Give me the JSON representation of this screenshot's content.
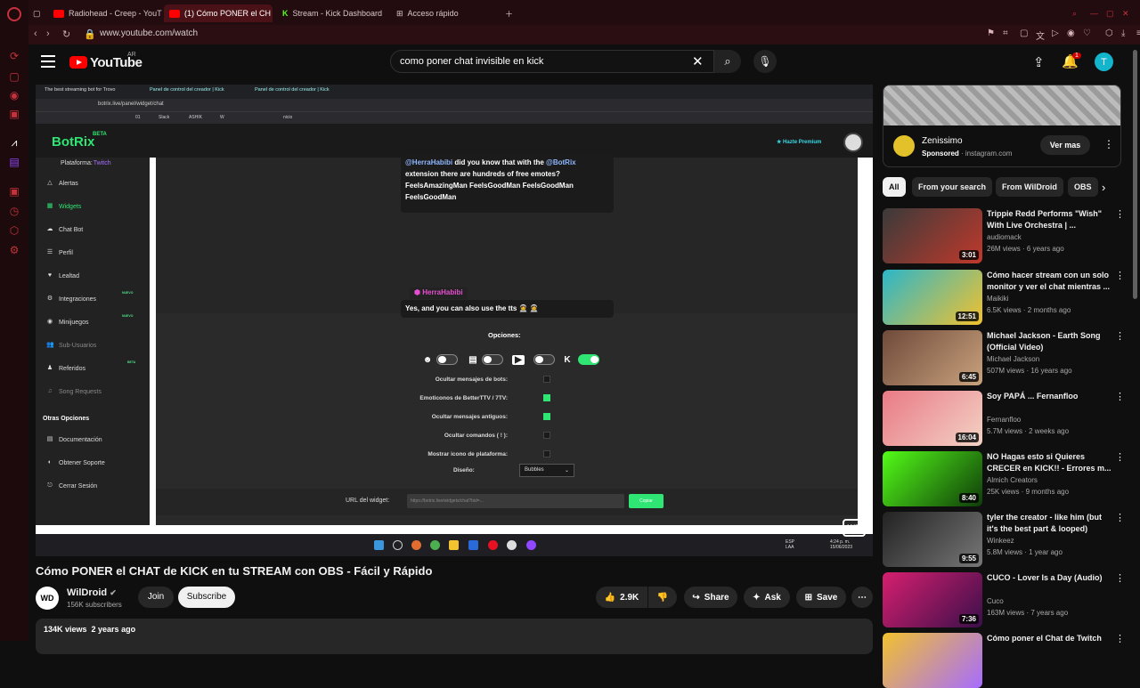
{
  "browser": {
    "tabs": [
      {
        "label": "Radiohead - Creep - YouT",
        "color": "#ff0000"
      },
      {
        "label": "(1) Cómo PONER el CH",
        "color": "#ff0000"
      },
      {
        "label": "Stream - Kick Dashboard",
        "color": "#53fc18"
      },
      {
        "label": "Acceso rápido",
        "color": "#888888"
      }
    ],
    "url": "www.youtube.com/watch"
  },
  "youtube": {
    "brand": "YouTube",
    "region": "AR",
    "search_query": "como poner chat invisible en kick",
    "notif_count": "1",
    "avatar_letter": "T"
  },
  "video_frame": {
    "tabs": [
      "The best streaming bot for Trovo",
      "Panel de control del creador | Kick",
      "Panel de control del creador | Kick"
    ],
    "url": "botrix.live/panel/widget/chat",
    "bookmarks": [
      "01",
      "Slack",
      "ASHIK",
      "W",
      "nicio"
    ],
    "logo": "BotRix",
    "beta": "BETA",
    "premium": "Hazte Premium",
    "platform_line": "Plataforma: ",
    "platform_value": "Twitch",
    "side_items": [
      {
        "label": "Alertas",
        "icon": "△"
      },
      {
        "label": "Widgets",
        "icon": "▦"
      },
      {
        "label": "Chat Bot",
        "icon": "☁"
      },
      {
        "label": "Perfil",
        "icon": "☰"
      },
      {
        "label": "Lealtad",
        "icon": "♥"
      },
      {
        "label": "Integraciones",
        "icon": "⚙"
      },
      {
        "label": "Minijuegos",
        "icon": "◉"
      },
      {
        "label": "Sub-Usuarios",
        "icon": "👥"
      },
      {
        "label": "Referidos",
        "icon": "♟"
      },
      {
        "label": "Song Requests",
        "icon": "♫"
      }
    ],
    "nuevo": "NUEVO",
    "beta_small": "BETA",
    "other_options": "Otras Opciones",
    "other_items": [
      {
        "label": "Documentación",
        "icon": "▤"
      },
      {
        "label": "Obtener Soporte",
        "icon": "◐"
      },
      {
        "label": "Cerrar Sesión",
        "icon": "⎋"
      }
    ],
    "chat_mention1": "@HerraHabibi",
    "chat_text1": " did you know that with the ",
    "chat_mention2": "@BotRix",
    "chat_text2": " extension there are hundreds of free emotes? FeelsAmazingMan FeelsGoodMan FeelsGoodMan FeelsGoodMan",
    "chat_user": "HerraHabibi",
    "chat_text3": "Yes, and you can also use the tts 🧑‍🚀 🧑‍🚀",
    "options_title": "Opciones:",
    "options": [
      {
        "label": "Ocultar mensajes de bots:",
        "checked": false
      },
      {
        "label": "Emoticonos de BetterTTV / 7TV:",
        "checked": true
      },
      {
        "label": "Ocultar mensajes antiguos:",
        "checked": true
      },
      {
        "label": "Ocultar comandos ( ! ):",
        "checked": false
      },
      {
        "label": "Mostrar icono de plataforma:",
        "checked": false
      }
    ],
    "design_label": "Diseño:",
    "design_value": "Bubbles",
    "url_label": "URL del widget:",
    "url_value": "https://botrix.live/widgets/chat?bid=...",
    "copy_label": "Copiar",
    "tb_lang": "ESP\nLAA",
    "tb_time": "4:24 p. m.\n15/06/2023",
    "watermark": "WD"
  },
  "video": {
    "title": "Cómo PONER el CHAT de KICK en tu STREAM con OBS - Fácil y Rápido",
    "channel": "WilDroid",
    "subscribers": "156K subscribers",
    "join": "Join",
    "subscribe": "Subscribe",
    "likes": "2.9K",
    "share": "Share",
    "ask": "Ask",
    "save": "Save",
    "views_date": "134K views  2 years ago"
  },
  "ad": {
    "name": "Zenissimo",
    "sponsored": "Sponsored",
    "domain": " · instagram.com",
    "button": "Ver mas"
  },
  "chips": [
    "All",
    "From your search",
    "From WilDroid",
    "OBS"
  ],
  "recommendations": [
    {
      "title": "Trippie Redd Performs \"Wish\" With Live Orchestra | ...",
      "channel": "audiomack",
      "meta": "26M views · 6 years ago",
      "duration": "3:01",
      "thumb": "#3a3a3a,#c0392b"
    },
    {
      "title": "Cómo hacer stream con un solo monitor y ver el chat mientras ...",
      "channel": "Maikiki",
      "meta": "6.5K views · 2 months ago",
      "duration": "12:51",
      "thumb": "#2bb6c9,#f2c12e"
    },
    {
      "title": "Michael Jackson - Earth Song (Official Video)",
      "channel": "Michael Jackson",
      "meta": "507M views · 16 years ago",
      "duration": "6:45",
      "thumb": "#6f4a3a,#c9a27d"
    },
    {
      "title": "Soy PAPÁ ... Fernanfloo",
      "channel": "Fernanfloo",
      "meta": "5.7M views · 2 weeks ago",
      "duration": "16:04",
      "thumb": "#e97a86,#f3d2c4"
    },
    {
      "title": "NO Hagas esto si Quieres CRECER en KICK!! - Errores m...",
      "channel": "Almich Creators",
      "meta": "25K views · 9 months ago",
      "duration": "8:40",
      "thumb": "#53fc18,#0f3c0a"
    },
    {
      "title": "tyler the creator - like him (but it's the best part & looped)",
      "channel": "Winkeez",
      "meta": "5.8M views · 1 year ago",
      "duration": "9:55",
      "thumb": "#222222,#777777"
    },
    {
      "title": "CUCO - Lover Is a Day (Audio)",
      "channel": "Cuco",
      "meta": "163M views · 7 years ago",
      "duration": "7:36",
      "thumb": "#d61f6f,#3b0f4a"
    },
    {
      "title": "Cómo poner el Chat de Twitch",
      "channel": "",
      "meta": "",
      "duration": "",
      "thumb": "#f2c12e,#a66cff"
    }
  ]
}
